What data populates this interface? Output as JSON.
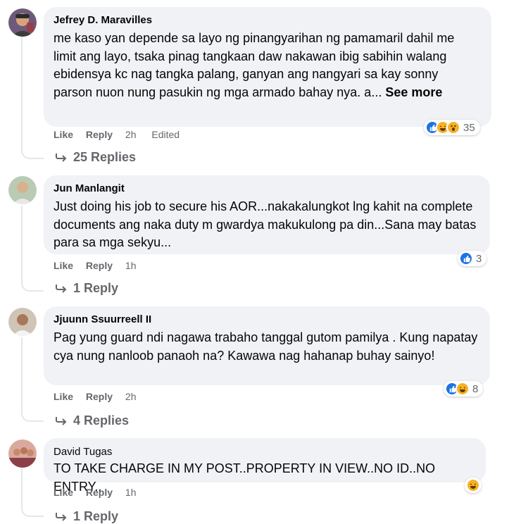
{
  "comments": [
    {
      "author": "Jefrey D. Maravilles",
      "text": "me kaso yan depende sa layo ng pinangyarihan ng pamamaril dahil me limit ang layo, tsaka pinag tangkaan daw nakawan ibig sabihin walang ebidensya kc nag tangka palang, ganyan ang nangyari sa kay sonny parson nuon nung pasukin ng mga armado bahay nya. a...",
      "see_more": "See more",
      "like_label": "Like",
      "reply_label": "Reply",
      "time": "2h",
      "edited": "Edited",
      "reactions": [
        "like",
        "haha",
        "wow"
      ],
      "reaction_count": "35",
      "replies_label": "25 Replies"
    },
    {
      "author": "Jun Manlangit",
      "text": "Just doing his job to secure his AOR...nakakalungkot lng kahit na complete documents ang naka duty m gwardya makukulong pa din...Sana may batas para sa mga sekyu...",
      "like_label": "Like",
      "reply_label": "Reply",
      "time": "1h",
      "reactions": [
        "like"
      ],
      "reaction_count": "3",
      "replies_label": "1 Reply"
    },
    {
      "author": "Jjuunn Ssuurreell II",
      "text": "Pag yung guard ndi nagawa trabaho tanggal gutom pamilya . Kung napatay cya nung nanloob panaoh na? Kawawa nag hahanap buhay sainyo!",
      "like_label": "Like",
      "reply_label": "Reply",
      "time": "2h",
      "reactions": [
        "like",
        "haha"
      ],
      "reaction_count": "8",
      "replies_label": "4 Replies"
    },
    {
      "author": "David Tugas",
      "text": "TO TAKE CHARGE IN MY POST..PROPERTY IN VIEW..NO ID..NO ENTRY..",
      "like_label": "Like",
      "reply_label": "Reply",
      "time": "1h",
      "reactions": [
        "haha"
      ],
      "reaction_count": "",
      "replies_label": "1 Reply"
    }
  ],
  "colors": {
    "bubble": "#f0f2f5",
    "meta_text": "#65676b",
    "like_blue": "#1b74e4",
    "haha_yellow": "#f7b125"
  }
}
